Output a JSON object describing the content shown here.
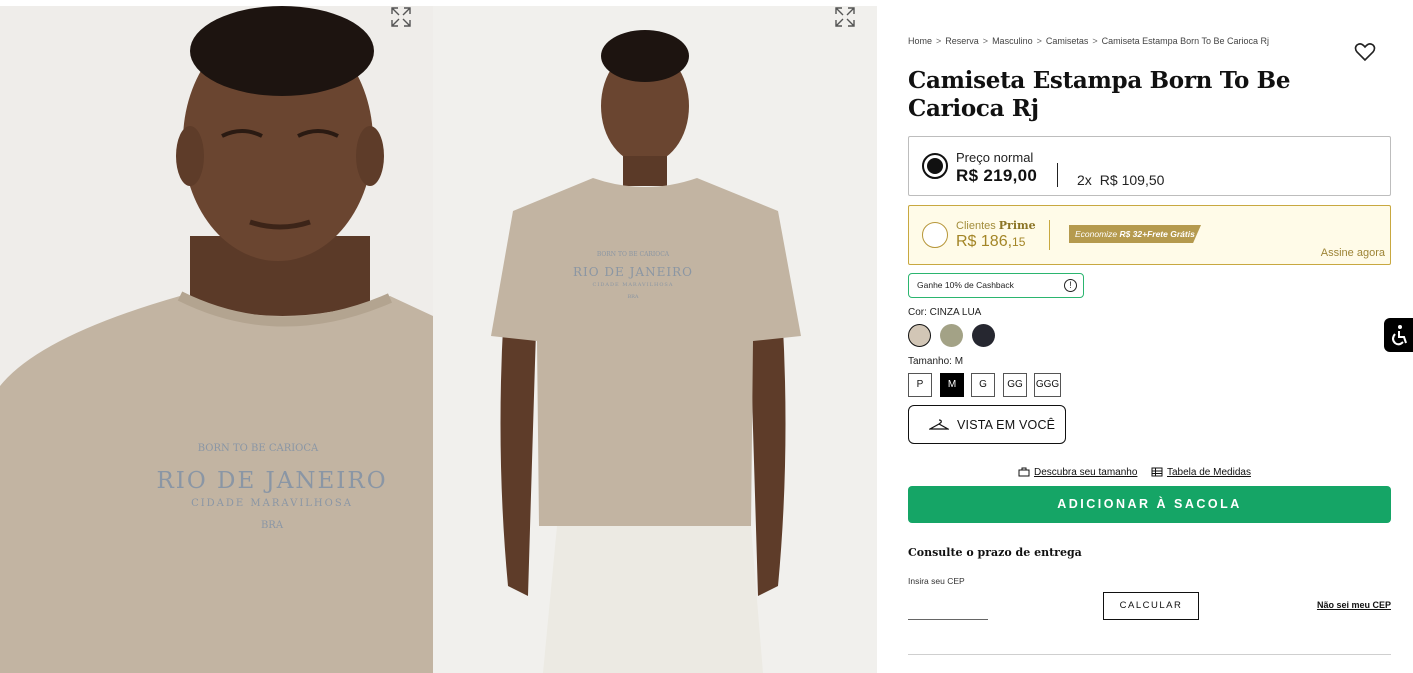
{
  "breadcrumb": [
    {
      "label": "Home"
    },
    {
      "label": "Reserva"
    },
    {
      "label": "Masculino"
    },
    {
      "label": "Camisetas"
    },
    {
      "label": "Camiseta Estampa Born To Be Carioca Rj"
    }
  ],
  "breadcrumb_separator": ">",
  "product": {
    "title": "Camiseta Estampa Born To Be Carioca Rj"
  },
  "pricing": {
    "normal_label": "Preço normal",
    "normal_price": "R$ 219,00",
    "installments": "2x",
    "installment_value": "R$ 109,50",
    "prime_label_prefix": "Clientes",
    "prime_label_brand": "Prime",
    "prime_price_main": "R$ 186,",
    "prime_price_cents": "15",
    "prime_tag_prefix": "Economize",
    "prime_tag_value": "R$ 32+Frete Grátis",
    "prime_cta": "Assine agora"
  },
  "cashback": {
    "label": "Ganhe 10% de Cashback",
    "icon": "info-icon",
    "icon_glyph": "!"
  },
  "color": {
    "label": "Cor: CINZA LUA",
    "swatches": [
      "#d2c6b6",
      "#a3a286",
      "#262730"
    ],
    "selected_index": 0
  },
  "size": {
    "label": "Tamanho: M",
    "options": [
      "P",
      "M",
      "G",
      "GG",
      "GGG"
    ],
    "selected": "M"
  },
  "try_on": {
    "label": "VISTA EM VOCÊ",
    "icon": "hanger-icon"
  },
  "size_links": {
    "discover": "Descubra seu tamanho",
    "table": "Tabela de Medidas"
  },
  "cart": {
    "add_label": "ADICIONAR À SACOLA"
  },
  "shipping": {
    "title": "Consulte o prazo de entrega",
    "cep_label": "Insira seu CEP",
    "cep_value": "",
    "calc_label": "CALCULAR",
    "no_cep_label": "Não sei meu CEP"
  },
  "print_text": {
    "line1": "BORN TO BE CARIOCA",
    "line2": "RIO DE JANEIRO",
    "line3": "CIDADE MARAVILHOSA",
    "line4": "BRA"
  },
  "colors": {
    "primary_green": "#15a566",
    "prime_gold": "#b59a4e",
    "prime_background": "#fffbe8",
    "cashback_border": "#2bb56f"
  }
}
